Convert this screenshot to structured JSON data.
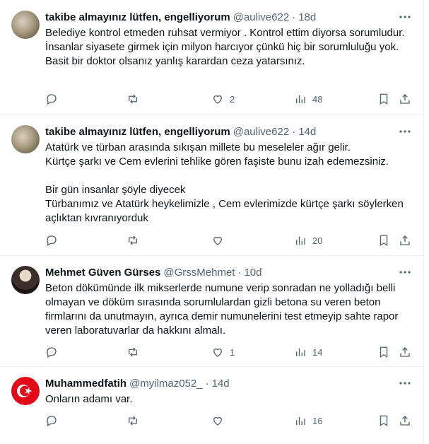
{
  "tweets": [
    {
      "name": "takibe almayınız lütfen, engelliyorum",
      "handle": "@aulive622",
      "time": "18d",
      "text": "Belediye kontrol etmeden ruhsat vermiyor . Kontrol ettim diyorsa sorumludur.\nİnsanlar siyasete girmek için milyon harcıyor çünkü hiç bir sorumluluğu yok.\nBasit bir doktor olsanız yanlış karardan ceza yatarsınız.",
      "replies": "",
      "reposts": "",
      "likes": "2",
      "views": "48",
      "avatar": "landscape-photo"
    },
    {
      "name": "takibe almayınız lütfen, engelliyorum",
      "handle": "@aulive622",
      "time": "14d",
      "text": "Atatürk ve türban arasında sıkışan millete bu meseleler ağır gelir.\nKürtçe şarkı ve Cem evlerini tehlike gören faşiste bunu izah edemezsiniz.\n\nBir gün insanlar şöyle diyecek\nTürbanımız ve Atatürk heykelimizle , Cem evlerimizde kürtçe şarkı söylerken açlıktan kıvranıyorduk",
      "replies": "",
      "reposts": "",
      "likes": "",
      "views": "20",
      "avatar": "landscape-photo"
    },
    {
      "name": "Mehmet Güven Gürses",
      "handle": "@GrssMehmet",
      "time": "10d",
      "text": "Beton dökümünde ilk mikserlerde numune verip sonradan ne yolladığı belli olmayan ve döküm sırasında sorumlulardan gizli betona su veren beton firmlarını da unutmayın, ayrıca demir numunelerini test etmeyip sahte rapor veren laboratuvarlar da hakkını almalı.",
      "replies": "",
      "reposts": "",
      "likes": "1",
      "views": "14",
      "avatar": "person-photo"
    },
    {
      "name": "Muhammedfatih",
      "handle": "@myilmaz052_",
      "time": "14d",
      "text": "Onların adamı var.",
      "replies": "",
      "reposts": "",
      "likes": "",
      "views": "16",
      "avatar": "turkish-flag"
    }
  ],
  "icons": {
    "reply": "reply-icon",
    "repost": "repost-icon",
    "like": "heart-icon",
    "views": "views-icon",
    "bookmark": "bookmark-icon",
    "share": "share-icon",
    "more": "more-icon"
  },
  "colors": {
    "text": "#0f1419",
    "secondary": "#536471",
    "divider": "#eff3f4",
    "flag_red": "#e30a17"
  }
}
